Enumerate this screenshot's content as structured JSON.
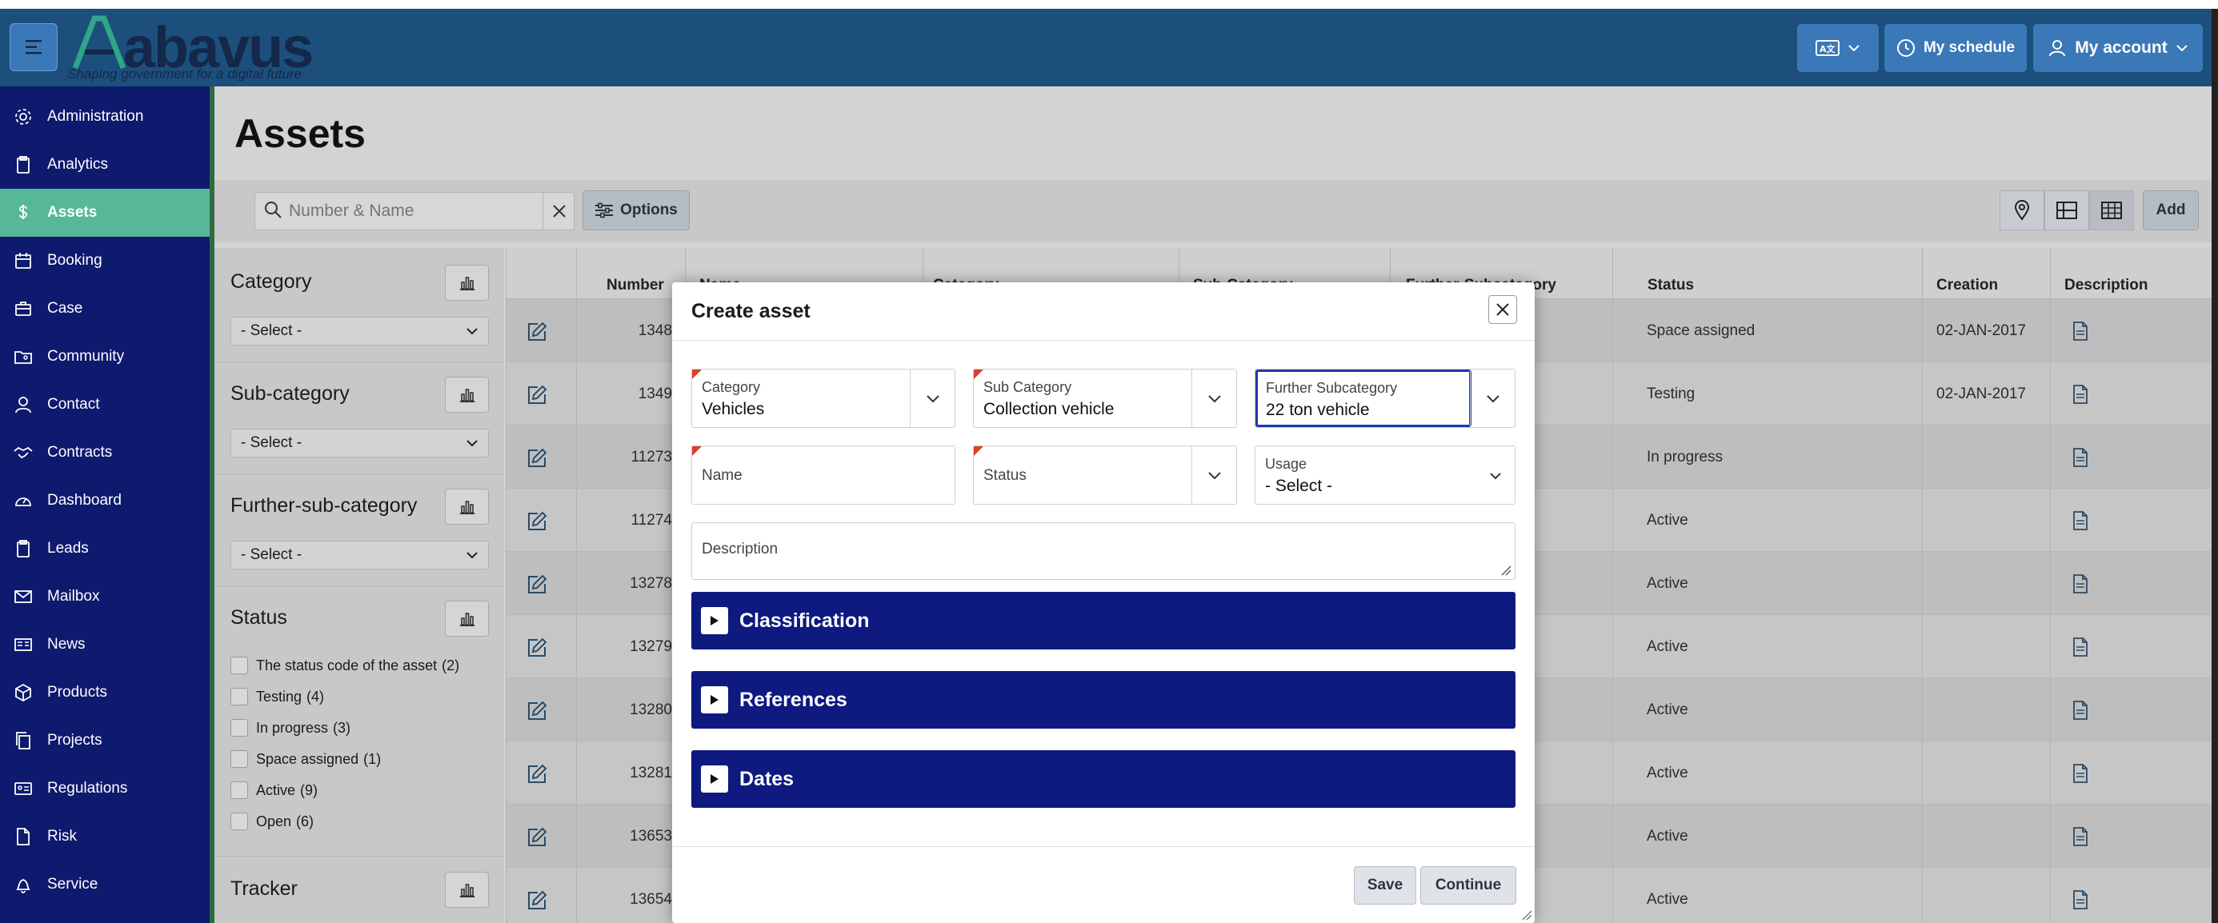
{
  "header": {
    "logo_text": "abavus",
    "logo_tagline": "Shaping government for a digital future",
    "my_schedule": "My schedule",
    "my_account": "My account"
  },
  "sidebar": {
    "items": [
      {
        "label": "Administration",
        "icon": "gear-icon"
      },
      {
        "label": "Analytics",
        "icon": "clipboard-icon"
      },
      {
        "label": "Assets",
        "icon": "dollar-icon",
        "active": true
      },
      {
        "label": "Booking",
        "icon": "calendar-icon"
      },
      {
        "label": "Case",
        "icon": "briefcase-icon"
      },
      {
        "label": "Community",
        "icon": "folder-user-icon"
      },
      {
        "label": "Contact",
        "icon": "user-icon"
      },
      {
        "label": "Contracts",
        "icon": "handshake-icon"
      },
      {
        "label": "Dashboard",
        "icon": "gauge-icon"
      },
      {
        "label": "Leads",
        "icon": "clipboard-icon"
      },
      {
        "label": "Mailbox",
        "icon": "mail-icon"
      },
      {
        "label": "News",
        "icon": "newspaper-icon"
      },
      {
        "label": "Products",
        "icon": "box-icon"
      },
      {
        "label": "Projects",
        "icon": "copy-icon"
      },
      {
        "label": "Regulations",
        "icon": "id-card-icon"
      },
      {
        "label": "Risk",
        "icon": "file-icon"
      },
      {
        "label": "Service",
        "icon": "bell-icon"
      }
    ]
  },
  "page": {
    "title": "Assets",
    "search_placeholder": "Number & Name",
    "options_label": "Options",
    "add_label": "Add"
  },
  "filters": {
    "category": {
      "title": "Category",
      "select": "- Select -"
    },
    "sub_category": {
      "title": "Sub-category",
      "select": "- Select -"
    },
    "further_sub_category": {
      "title": "Further-sub-category",
      "select": "- Select -"
    },
    "status": {
      "title": "Status",
      "options": [
        {
          "label": "The status code of the asset",
          "count": "(2)"
        },
        {
          "label": "Testing",
          "count": "(4)"
        },
        {
          "label": "In progress",
          "count": "(3)"
        },
        {
          "label": "Space assigned",
          "count": "(1)"
        },
        {
          "label": "Active",
          "count": "(9)"
        },
        {
          "label": "Open",
          "count": "(6)"
        }
      ]
    },
    "tracker": {
      "title": "Tracker"
    }
  },
  "table": {
    "columns": [
      "Number",
      "Name",
      "Category",
      "Sub-Category",
      "Further-Subcategory",
      "Status",
      "Creation",
      "Description"
    ],
    "rows": [
      {
        "number": "1348",
        "status": "Space assigned",
        "creation": "02-JAN-2017"
      },
      {
        "number": "1349",
        "status": "Testing",
        "creation": "02-JAN-2017"
      },
      {
        "number": "11273",
        "status": "In progress",
        "creation": ""
      },
      {
        "number": "11274",
        "status": "Active",
        "creation": ""
      },
      {
        "number": "13278",
        "status": "Active",
        "creation": ""
      },
      {
        "number": "13279",
        "status": "Active",
        "creation": ""
      },
      {
        "number": "13280",
        "status": "Active",
        "creation": ""
      },
      {
        "number": "13281",
        "status": "Active",
        "creation": ""
      },
      {
        "number": "13653",
        "status": "Active",
        "creation": ""
      },
      {
        "number": "13654",
        "status": "Active",
        "creation": ""
      }
    ]
  },
  "modal": {
    "title": "Create asset",
    "category_label": "Category",
    "category_value": "Vehicles",
    "sub_category_label": "Sub Category",
    "sub_category_value": "Collection vehicle",
    "further_sub_label": "Further Subcategory",
    "further_sub_value": "22 ton vehicle",
    "name_label": "Name",
    "status_label": "Status",
    "usage_label": "Usage",
    "usage_value": "- Select -",
    "description_label": "Description",
    "regions": [
      "Classification",
      "References",
      "Dates"
    ],
    "save_label": "Save",
    "continue_label": "Continue"
  }
}
